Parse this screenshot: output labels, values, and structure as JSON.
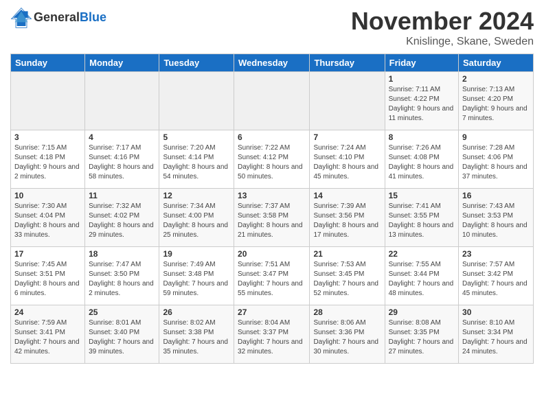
{
  "header": {
    "logo_line1": "General",
    "logo_line2": "Blue",
    "month_title": "November 2024",
    "location": "Knislinge, Skane, Sweden"
  },
  "days_of_week": [
    "Sunday",
    "Monday",
    "Tuesday",
    "Wednesday",
    "Thursday",
    "Friday",
    "Saturday"
  ],
  "weeks": [
    [
      {
        "day": "",
        "info": ""
      },
      {
        "day": "",
        "info": ""
      },
      {
        "day": "",
        "info": ""
      },
      {
        "day": "",
        "info": ""
      },
      {
        "day": "",
        "info": ""
      },
      {
        "day": "1",
        "info": "Sunrise: 7:11 AM\nSunset: 4:22 PM\nDaylight: 9 hours and 11 minutes."
      },
      {
        "day": "2",
        "info": "Sunrise: 7:13 AM\nSunset: 4:20 PM\nDaylight: 9 hours and 7 minutes."
      }
    ],
    [
      {
        "day": "3",
        "info": "Sunrise: 7:15 AM\nSunset: 4:18 PM\nDaylight: 9 hours and 2 minutes."
      },
      {
        "day": "4",
        "info": "Sunrise: 7:17 AM\nSunset: 4:16 PM\nDaylight: 8 hours and 58 minutes."
      },
      {
        "day": "5",
        "info": "Sunrise: 7:20 AM\nSunset: 4:14 PM\nDaylight: 8 hours and 54 minutes."
      },
      {
        "day": "6",
        "info": "Sunrise: 7:22 AM\nSunset: 4:12 PM\nDaylight: 8 hours and 50 minutes."
      },
      {
        "day": "7",
        "info": "Sunrise: 7:24 AM\nSunset: 4:10 PM\nDaylight: 8 hours and 45 minutes."
      },
      {
        "day": "8",
        "info": "Sunrise: 7:26 AM\nSunset: 4:08 PM\nDaylight: 8 hours and 41 minutes."
      },
      {
        "day": "9",
        "info": "Sunrise: 7:28 AM\nSunset: 4:06 PM\nDaylight: 8 hours and 37 minutes."
      }
    ],
    [
      {
        "day": "10",
        "info": "Sunrise: 7:30 AM\nSunset: 4:04 PM\nDaylight: 8 hours and 33 minutes."
      },
      {
        "day": "11",
        "info": "Sunrise: 7:32 AM\nSunset: 4:02 PM\nDaylight: 8 hours and 29 minutes."
      },
      {
        "day": "12",
        "info": "Sunrise: 7:34 AM\nSunset: 4:00 PM\nDaylight: 8 hours and 25 minutes."
      },
      {
        "day": "13",
        "info": "Sunrise: 7:37 AM\nSunset: 3:58 PM\nDaylight: 8 hours and 21 minutes."
      },
      {
        "day": "14",
        "info": "Sunrise: 7:39 AM\nSunset: 3:56 PM\nDaylight: 8 hours and 17 minutes."
      },
      {
        "day": "15",
        "info": "Sunrise: 7:41 AM\nSunset: 3:55 PM\nDaylight: 8 hours and 13 minutes."
      },
      {
        "day": "16",
        "info": "Sunrise: 7:43 AM\nSunset: 3:53 PM\nDaylight: 8 hours and 10 minutes."
      }
    ],
    [
      {
        "day": "17",
        "info": "Sunrise: 7:45 AM\nSunset: 3:51 PM\nDaylight: 8 hours and 6 minutes."
      },
      {
        "day": "18",
        "info": "Sunrise: 7:47 AM\nSunset: 3:50 PM\nDaylight: 8 hours and 2 minutes."
      },
      {
        "day": "19",
        "info": "Sunrise: 7:49 AM\nSunset: 3:48 PM\nDaylight: 7 hours and 59 minutes."
      },
      {
        "day": "20",
        "info": "Sunrise: 7:51 AM\nSunset: 3:47 PM\nDaylight: 7 hours and 55 minutes."
      },
      {
        "day": "21",
        "info": "Sunrise: 7:53 AM\nSunset: 3:45 PM\nDaylight: 7 hours and 52 minutes."
      },
      {
        "day": "22",
        "info": "Sunrise: 7:55 AM\nSunset: 3:44 PM\nDaylight: 7 hours and 48 minutes."
      },
      {
        "day": "23",
        "info": "Sunrise: 7:57 AM\nSunset: 3:42 PM\nDaylight: 7 hours and 45 minutes."
      }
    ],
    [
      {
        "day": "24",
        "info": "Sunrise: 7:59 AM\nSunset: 3:41 PM\nDaylight: 7 hours and 42 minutes."
      },
      {
        "day": "25",
        "info": "Sunrise: 8:01 AM\nSunset: 3:40 PM\nDaylight: 7 hours and 39 minutes."
      },
      {
        "day": "26",
        "info": "Sunrise: 8:02 AM\nSunset: 3:38 PM\nDaylight: 7 hours and 35 minutes."
      },
      {
        "day": "27",
        "info": "Sunrise: 8:04 AM\nSunset: 3:37 PM\nDaylight: 7 hours and 32 minutes."
      },
      {
        "day": "28",
        "info": "Sunrise: 8:06 AM\nSunset: 3:36 PM\nDaylight: 7 hours and 30 minutes."
      },
      {
        "day": "29",
        "info": "Sunrise: 8:08 AM\nSunset: 3:35 PM\nDaylight: 7 hours and 27 minutes."
      },
      {
        "day": "30",
        "info": "Sunrise: 8:10 AM\nSunset: 3:34 PM\nDaylight: 7 hours and 24 minutes."
      }
    ]
  ]
}
